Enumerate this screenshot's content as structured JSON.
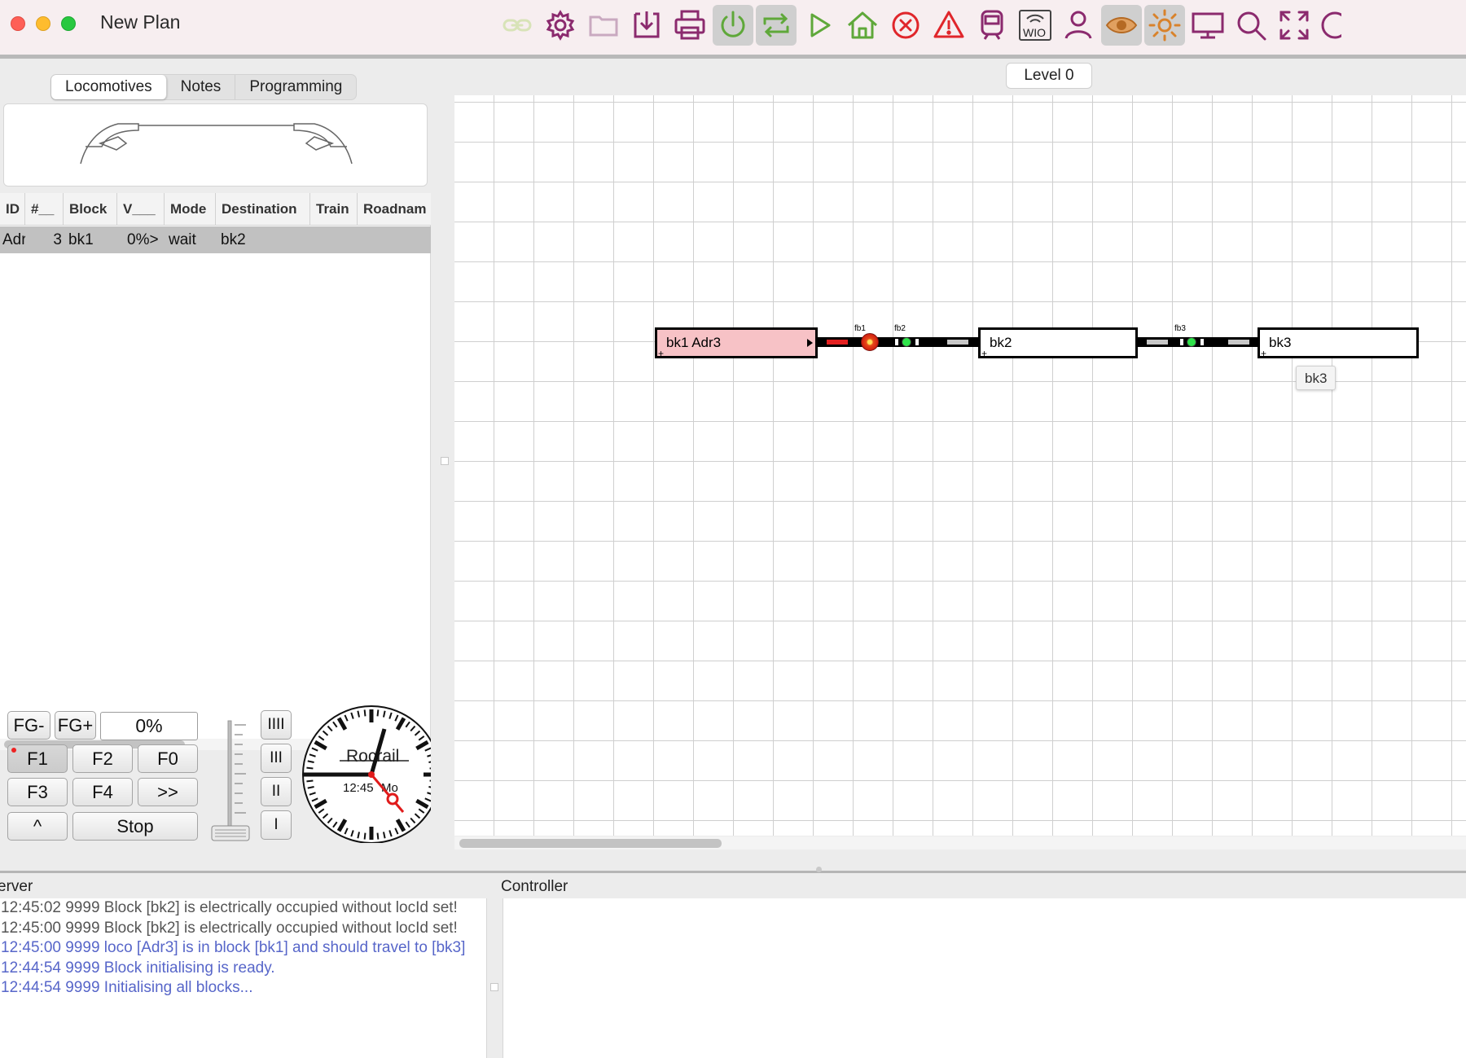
{
  "window": {
    "title": "New Plan"
  },
  "toolbar": {
    "icons": [
      "link-icon",
      "gear-icon",
      "folder-icon",
      "download-icon",
      "printer-icon",
      "power-icon",
      "cycle-icon",
      "play-icon",
      "home-icon",
      "stop-circle-icon",
      "warning-icon",
      "train-icon",
      "wio-icon",
      "user-icon",
      "eye-icon",
      "sun-icon",
      "monitor-icon",
      "search-icon",
      "fullscreen-icon",
      "clock-icon"
    ],
    "wio_label": "WIO",
    "accent_color": "#8b2a6e",
    "green_color": "#5fa83a"
  },
  "left_tabs": [
    {
      "label": "Locomotives",
      "selected": true
    },
    {
      "label": "Notes",
      "selected": false
    },
    {
      "label": "Programming",
      "selected": false
    }
  ],
  "loco_table": {
    "headers": [
      "ID",
      "#__",
      "Block",
      "V___",
      "Mode",
      "Destination",
      "Train",
      "Roadnam"
    ],
    "rows": [
      {
        "id": "Adr",
        "num": "3",
        "block": "bk1",
        "v": "0%>",
        "mode": "wait",
        "destination": "bk2",
        "train": "",
        "roadname": ""
      }
    ]
  },
  "throttle": {
    "fg_minus": "FG-",
    "fg_plus": "FG+",
    "speed": "0%",
    "speed_level": 0,
    "functions": [
      "F1",
      "F2",
      "F0",
      "F3",
      "F4",
      ">>"
    ],
    "caret": "^",
    "stop": "Stop",
    "gears": [
      "IIII",
      "III",
      "II",
      "I"
    ]
  },
  "clock": {
    "brand": "Rocrail",
    "time": "12:45",
    "day": "Mo"
  },
  "plan": {
    "level_tab": "Level 0",
    "blocks": [
      {
        "id": "bk1",
        "label": "bk1 Adr3",
        "occupied": true
      },
      {
        "id": "bk2",
        "label": "bk2",
        "occupied": false
      },
      {
        "id": "bk3",
        "label": "bk3",
        "occupied": false
      }
    ],
    "sensors": [
      {
        "id": "fb1",
        "state": "signal"
      },
      {
        "id": "fb2",
        "state": "free"
      },
      {
        "id": "fb3",
        "state": "free"
      }
    ],
    "tooltip": "bk3"
  },
  "server": {
    "title": "erver",
    "log": [
      {
        "text": "12:45:02 9999 Block [bk2] is electrically occupied without locId set!",
        "level": "warn"
      },
      {
        "text": "12:45:00 9999 Block [bk2] is electrically occupied without locId set!",
        "level": "warn"
      },
      {
        "text": "12:45:00 9999 loco [Adr3] is in block [bk1] and should travel to [bk3]",
        "level": "info"
      },
      {
        "text": "12:44:54 9999 Block initialising is ready.",
        "level": "info"
      },
      {
        "text": "12:44:54 9999 Initialising all blocks...",
        "level": "info"
      }
    ]
  },
  "controller": {
    "title": "Controller"
  }
}
